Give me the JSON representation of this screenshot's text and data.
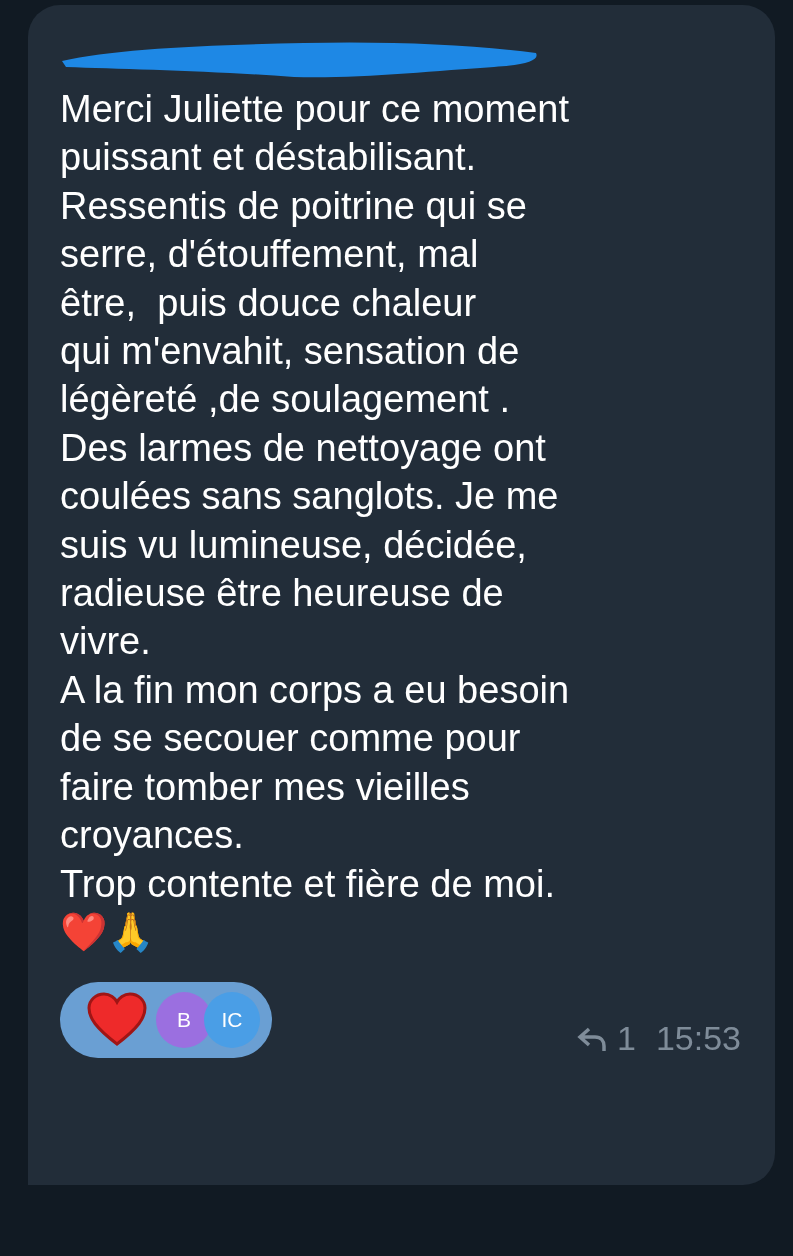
{
  "message": {
    "sender_redacted": true,
    "text": "Merci Juliette pour ce moment\npuissant et déstabilisant.\nRessentis de poitrine qui se\nserre, d'étouffement, mal\nêtre,  puis douce chaleur\nqui m'envahit, sensation de\nlégèreté ,de soulagement .\nDes larmes de nettoyage ont\ncoulées sans sanglots. Je me\nsuis vu lumineuse, décidée,\nradieuse être heureuse de\nvivre.\nA la fin mon corps a eu besoin\nde se secouer comme pour\nfaire tomber mes vieilles\ncroyances.\nTrop contente et fière de moi.\n❤️🙏",
    "reactions": [
      {
        "avatars": [
          {
            "initials": "B",
            "color": "#9b6fe0"
          },
          {
            "initials": "IC",
            "color": "#4a9ee6"
          }
        ],
        "selected": true
      }
    ],
    "reply_count": "1",
    "time": "15:53"
  }
}
